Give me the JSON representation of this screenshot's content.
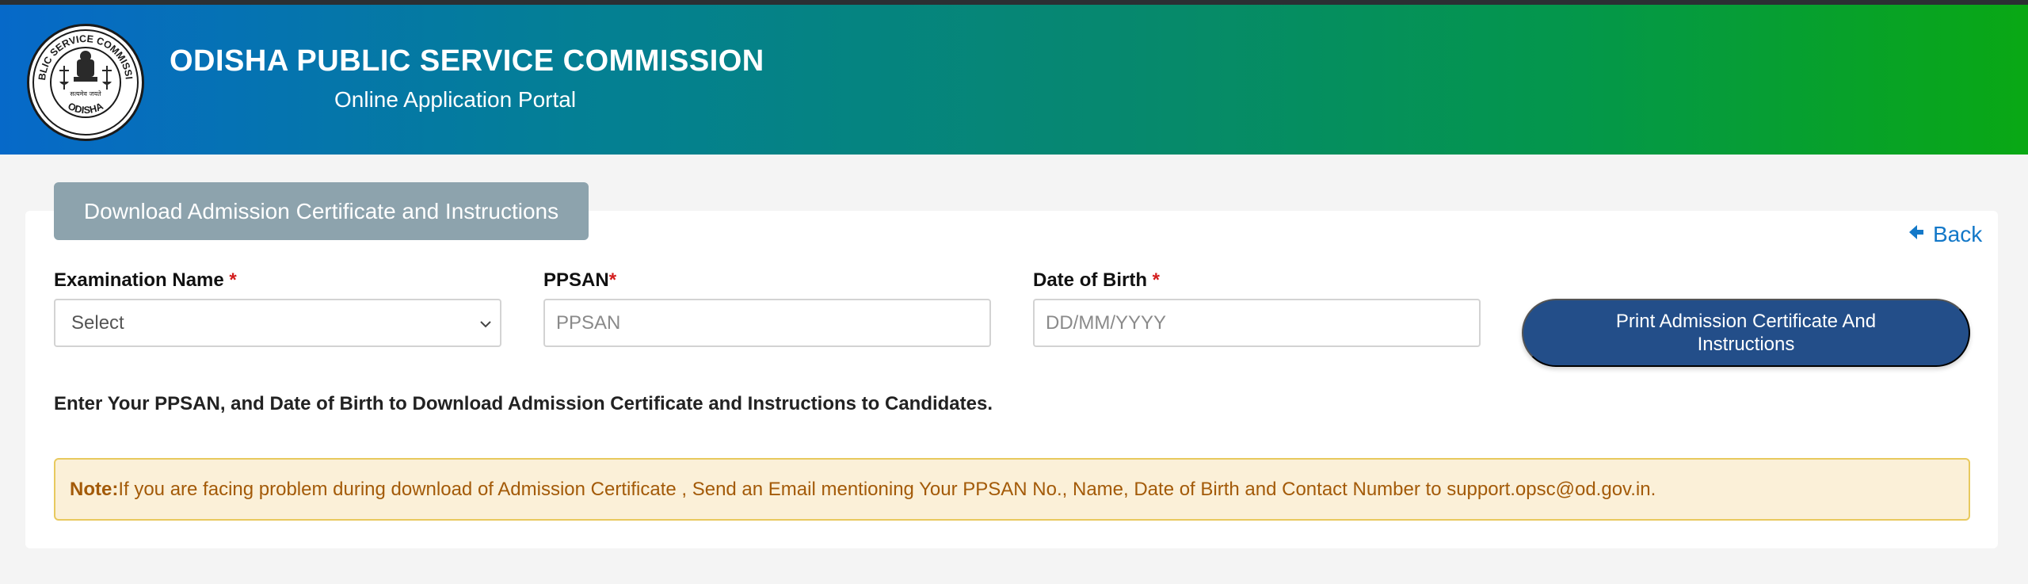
{
  "header": {
    "title": "ODISHA PUBLIC SERVICE COMMISSION",
    "subtitle": "Online Application Portal",
    "logo": {
      "ring_text_top": "PUBLIC SERVICE COMMISSION",
      "ring_text_bottom": "ODISHA",
      "motto": "सत्यमेव जयते"
    }
  },
  "panel": {
    "tab_label": "Download Admission Certificate and Instructions",
    "back_label": "Back",
    "back_icon": "arrow-left-icon"
  },
  "form": {
    "exam_name": {
      "label": "Examination Name",
      "required_mark": "*",
      "value": "Select"
    },
    "ppsan": {
      "label": "PPSAN",
      "required_mark": "*",
      "placeholder": "PPSAN"
    },
    "dob": {
      "label": "Date of Birth",
      "required_mark": "*",
      "placeholder": "DD/MM/YYYY"
    },
    "print_button": "Print Admission Certificate And Instructions"
  },
  "instruction": "Enter Your PPSAN, and Date of Birth to Download Admission Certificate and Instructions to Candidates.",
  "note": {
    "prefix": "Note:",
    "text": "If you are facing problem during download of Admission Certificate , Send an Email mentioning Your PPSAN No., Name, Date of Birth and Contact Number to support.opsc@od.gov.in."
  },
  "colors": {
    "header_start": "#0669c9",
    "header_end": "#09a814",
    "tab_bg": "#8da3ad",
    "button_bg": "#234e89",
    "link": "#1378c8",
    "required": "#d31c1c",
    "note_bg": "#fbf0d8",
    "note_text": "#a35a08"
  }
}
